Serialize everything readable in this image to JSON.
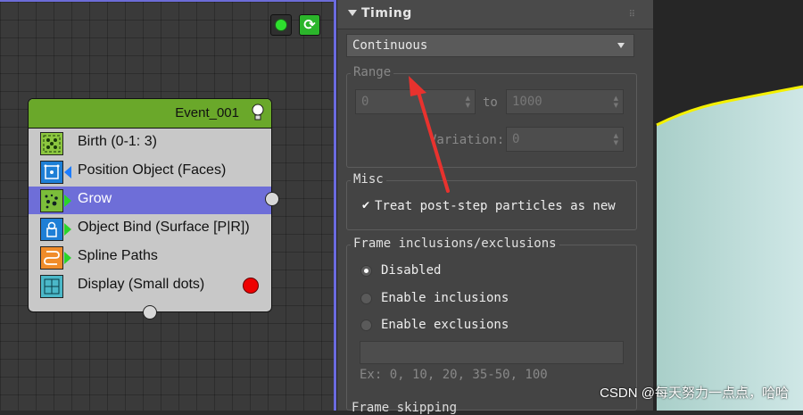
{
  "node_toolbar": {
    "show_all_icon": "green-dot-icon",
    "refresh_icon": "refresh-icon",
    "refresh_glyph": "⟳"
  },
  "event": {
    "title": "Event_001",
    "header_color": "#6aa82a",
    "operators": [
      {
        "label": "Birth (0-1: 3)",
        "icon": "birth-icon"
      },
      {
        "label": "Position Object (Faces)",
        "icon": "position-object-icon"
      },
      {
        "label": "Grow",
        "icon": "grow-icon",
        "selected": true
      },
      {
        "label": "Object Bind (Surface [P|R])",
        "icon": "object-bind-icon"
      },
      {
        "label": "Spline Paths",
        "icon": "spline-paths-icon"
      },
      {
        "label": "Display (Small dots)",
        "icon": "display-icon"
      }
    ],
    "selected_color": "#6e6ed8"
  },
  "panel": {
    "title": "Timing",
    "mode": "Continuous",
    "range": {
      "title": "Range",
      "from": "0",
      "to_label": "to",
      "to": "1000",
      "variation_label": "Variation:",
      "variation": "0"
    },
    "misc": {
      "title": "Misc",
      "checkbox_label": "Treat post-step particles as new",
      "checked": true
    },
    "frames": {
      "title": "Frame inclusions/exclusions",
      "options": [
        "Disabled",
        "Enable inclusions",
        "Enable exclusions"
      ],
      "selected": 0,
      "hint": "Ex: 0, 10, 20, 35-50, 100"
    },
    "frame_skipping_title": "Frame skipping"
  },
  "annotation_arrow_color": "#e8322e",
  "watermark": "CSDN @每天努力一点点，哈哈"
}
